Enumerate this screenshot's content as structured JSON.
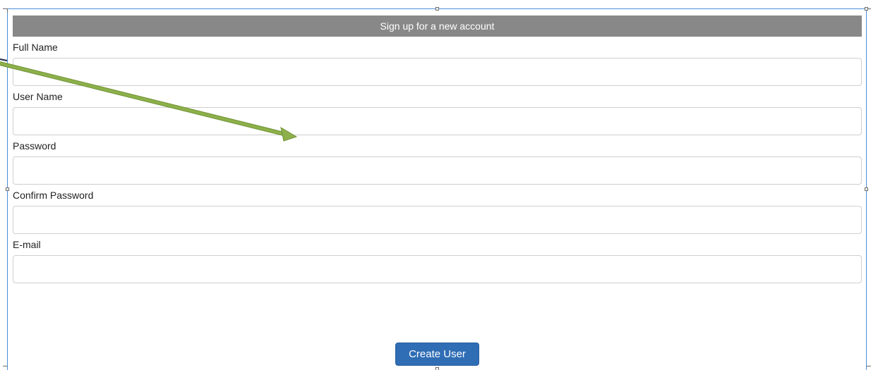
{
  "form": {
    "title": "Sign up for a new account",
    "fields": [
      {
        "label": "Full Name",
        "value": "",
        "placeholder": ""
      },
      {
        "label": "User Name",
        "value": "",
        "placeholder": ""
      },
      {
        "label": "Password",
        "value": "",
        "placeholder": ""
      },
      {
        "label": "Confirm Password",
        "value": "",
        "placeholder": ""
      },
      {
        "label": "E-mail",
        "value": "",
        "placeholder": ""
      }
    ],
    "submit_label": "Create User"
  },
  "colors": {
    "header_bg": "#888888",
    "button_bg": "#2f6db5",
    "selection_frame": "#4a90d9",
    "annotation_arrow": "#8db04a"
  }
}
